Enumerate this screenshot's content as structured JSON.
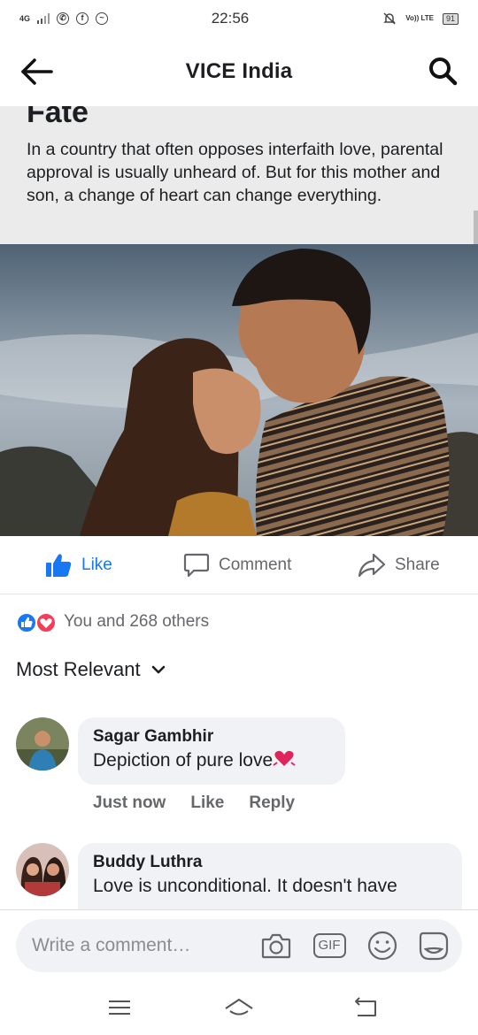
{
  "status_bar": {
    "network": "4G",
    "time": "22:56",
    "volte": "Vo)) LTE",
    "battery": "91"
  },
  "header": {
    "title": "VICE India",
    "back_icon": "arrow-left-icon",
    "search_icon": "search-icon"
  },
  "article": {
    "headline": "Fate",
    "description": "In a country that often opposes interfaith love, parental approval is usually unheard of. But for this mother and son, a change of heart can change everything."
  },
  "actions": {
    "like": "Like",
    "comment": "Comment",
    "share": "Share"
  },
  "reactions": {
    "summary": "You and 268 others"
  },
  "sort": {
    "label": "Most Relevant"
  },
  "comments": [
    {
      "author": "Sagar Gambhir",
      "text": "Depiction of pure love",
      "time": "Just now",
      "like": "Like",
      "reply": "Reply"
    },
    {
      "author": "Buddy Luthra",
      "text": "Love is unconditional. It doesn't have"
    }
  ],
  "composer": {
    "placeholder": "Write a comment…",
    "gif": "GIF"
  },
  "colors": {
    "accent": "#1877f2",
    "love": "#f33e58",
    "muted": "#65676b"
  }
}
